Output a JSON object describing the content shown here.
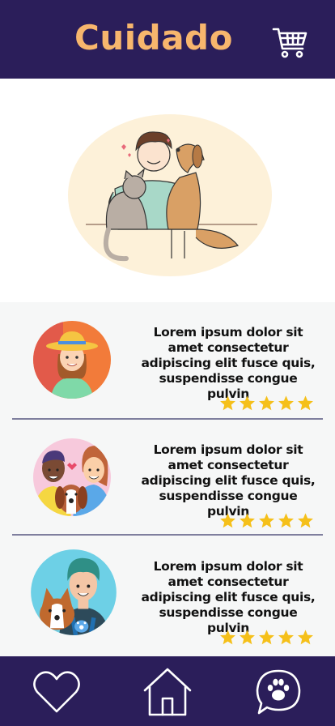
{
  "header": {
    "title": "Cuidado",
    "cart_icon": "shopping-cart-icon"
  },
  "hero": {
    "illustration": "person hugging cat and dog"
  },
  "colors": {
    "brand_dark": "#2b1e5a",
    "title_accent": "#f7b66d",
    "star": "#f5c01a",
    "divider": "#7f7f9e"
  },
  "cards": [
    {
      "text": "Lorem ipsum dolor sit amet consectetur adipiscing elit fusce quis, suspendisse congue pulvin",
      "rating": 5,
      "avatar": "woman-with-hat"
    },
    {
      "text": "Lorem ipsum dolor sit amet consectetur adipiscing elit fusce quis, suspendisse congue pulvin",
      "rating": 5,
      "avatar": "couple-with-dog"
    },
    {
      "text": "Lorem ipsum dolor sit amet consectetur adipiscing elit fusce quis, suspendisse congue pulvin",
      "rating": 5,
      "avatar": "man-with-corgi"
    }
  ],
  "bottom_nav": {
    "items": [
      {
        "icon": "heart-icon"
      },
      {
        "icon": "home-icon"
      },
      {
        "icon": "paw-chat-icon"
      }
    ]
  }
}
